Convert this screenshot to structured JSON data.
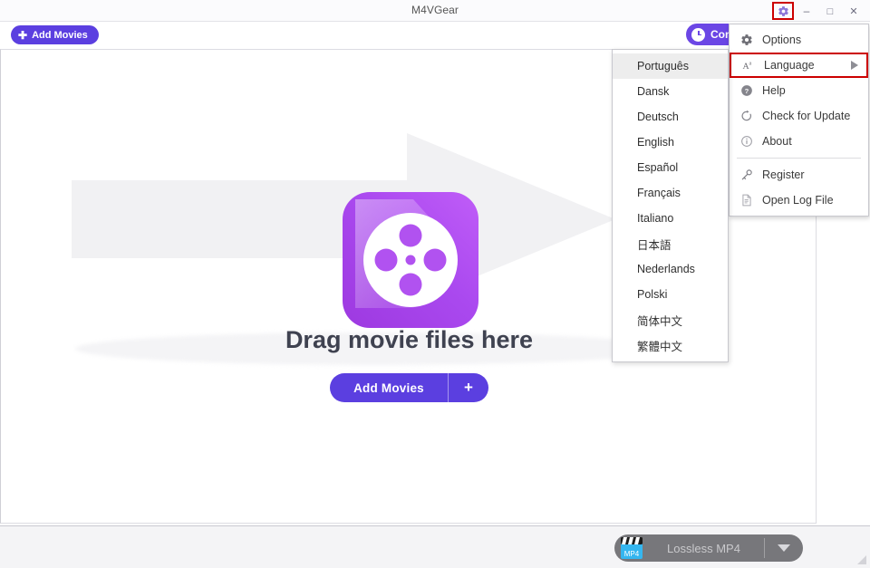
{
  "window": {
    "title": "M4VGear",
    "controls": {
      "settings_icon": "gear-icon",
      "minimize": "–",
      "maximize": "□",
      "close": "✕"
    }
  },
  "toolbar": {
    "add_movies_label": "Add Movies",
    "add_movies_icon": "plus-icon",
    "convert_label": "Convert",
    "convert_icon": "clock-icon"
  },
  "main": {
    "drop_text": "Drag movie files here",
    "add_movies_label": "Add Movies",
    "add_movies_plus": "+",
    "app_icon": "film-reel-icon",
    "watermark_icon": "arrow-right-watermark"
  },
  "footer": {
    "format_label": "Lossless MP4",
    "format_icon": "clapperboard-icon",
    "dropdown_icon": "caret-down-icon"
  },
  "menu": {
    "items": [
      {
        "label": "Options",
        "icon": "gear-icon",
        "has_submenu": false,
        "highlight": false
      },
      {
        "label": "Language",
        "icon": "language-icon",
        "has_submenu": true,
        "highlight": true
      },
      {
        "label": "Help",
        "icon": "help-circle-icon",
        "has_submenu": false,
        "highlight": false
      },
      {
        "label": "Check for Update",
        "icon": "refresh-icon",
        "has_submenu": false,
        "highlight": false
      },
      {
        "label": "About",
        "icon": "info-circle-icon",
        "has_submenu": false,
        "highlight": false
      },
      {
        "label": "Register",
        "icon": "key-icon",
        "has_submenu": false,
        "highlight": false,
        "separator_before": true
      },
      {
        "label": "Open Log File",
        "icon": "log-file-icon",
        "has_submenu": false,
        "highlight": false
      }
    ]
  },
  "language_submenu": {
    "items": [
      {
        "label": "Português",
        "selected": true
      },
      {
        "label": "Dansk",
        "selected": false
      },
      {
        "label": "Deutsch",
        "selected": false
      },
      {
        "label": "English",
        "selected": false
      },
      {
        "label": "Español",
        "selected": false
      },
      {
        "label": "Français",
        "selected": false
      },
      {
        "label": "Italiano",
        "selected": false
      },
      {
        "label": "日本語",
        "selected": false
      },
      {
        "label": "Nederlands",
        "selected": false
      },
      {
        "label": "Polski",
        "selected": false
      },
      {
        "label": "简体中文",
        "selected": false
      },
      {
        "label": "繁體中文",
        "selected": false
      }
    ]
  },
  "colors": {
    "accent_purple": "#5b3fe0",
    "convert_purple": "#6b46e5",
    "highlight_red": "#cc0000",
    "footer_gray": "#f4f4f6",
    "pill_gray": "#77777b"
  }
}
